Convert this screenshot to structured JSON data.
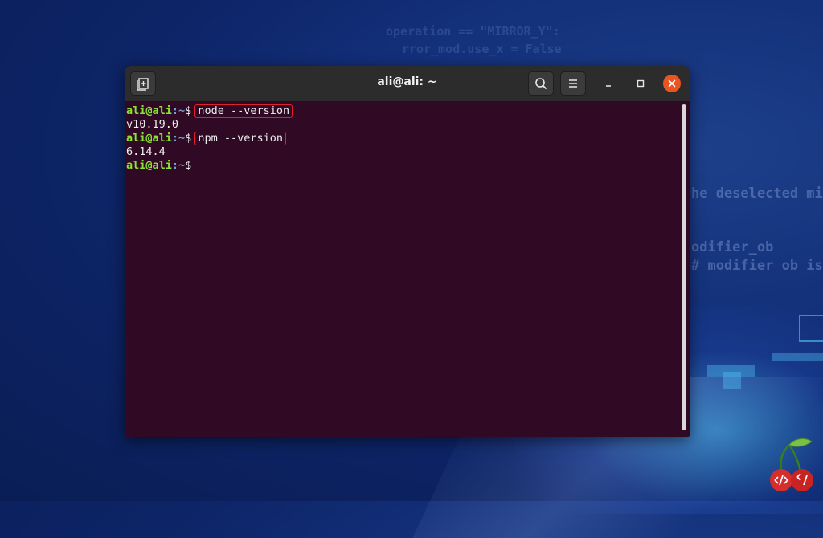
{
  "window": {
    "title": "ali@ali: ~"
  },
  "terminal": {
    "prompt_user": "ali@ali",
    "prompt_path": ":~",
    "prompt_symbol": "$",
    "lines": [
      {
        "type": "prompt",
        "command": "node --version"
      },
      {
        "type": "output",
        "text": "v10.19.0"
      },
      {
        "type": "prompt",
        "command": "npm --version"
      },
      {
        "type": "output",
        "text": "6.14.4"
      },
      {
        "type": "prompt",
        "command": ""
      }
    ]
  },
  "background": {
    "code_lines": [
      "operation == \"MIRROR_Y\":",
      "rror_mod.use_x = False",
      "he deselected mi",
      "odifier_ob",
      "# modifier ob is"
    ]
  },
  "colors": {
    "terminal_bg": "#300a24",
    "prompt_user": "#8ae234",
    "prompt_path": "#729fcf",
    "highlight_box": "#e0202a",
    "close_button": "#e95420"
  },
  "icons": {
    "new_tab": "new-tab-icon",
    "search": "search-icon",
    "menu": "hamburger-menu-icon",
    "minimize": "minimize-icon",
    "maximize": "maximize-icon",
    "close": "close-icon",
    "logo": "cherry-code-logo"
  }
}
